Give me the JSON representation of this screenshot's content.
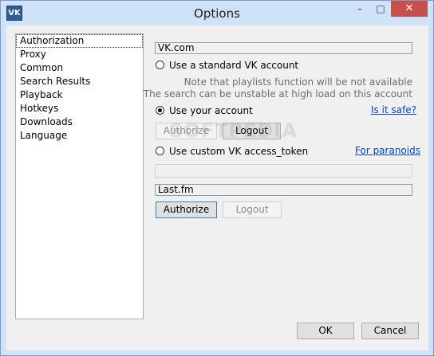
{
  "window": {
    "title": "Options",
    "icon_name": "vk-app-icon",
    "minimize_glyph": "–",
    "maximize_glyph": "□",
    "close_glyph": "✕"
  },
  "sidebar": {
    "items": [
      {
        "label": "Authorization",
        "selected": true
      },
      {
        "label": "Proxy"
      },
      {
        "label": "Common"
      },
      {
        "label": "Search Results"
      },
      {
        "label": "Playback"
      },
      {
        "label": "Hotkeys"
      },
      {
        "label": "Downloads"
      },
      {
        "label": "Language"
      }
    ]
  },
  "vk": {
    "group_label": "VK.com",
    "standard_account_label": "Use a standard VK account",
    "note_line1": "Note that playlists function will be not available",
    "note_line2": "The search can be unstable at high load on this account",
    "own_account_label": "Use your account",
    "is_it_safe_link": "Is it safe?",
    "authorize_label": "Authorize",
    "logout_label": "Logout",
    "custom_token_label": "Use custom VK access_token",
    "paranoids_link": "For paranoids",
    "token_value": "",
    "selected": "own_account"
  },
  "lastfm": {
    "group_label": "Last.fm",
    "authorize_label": "Authorize",
    "logout_label": "Logout"
  },
  "footer": {
    "ok_label": "OK",
    "cancel_label": "Cancel"
  },
  "watermark": "SOFTPEDIA"
}
